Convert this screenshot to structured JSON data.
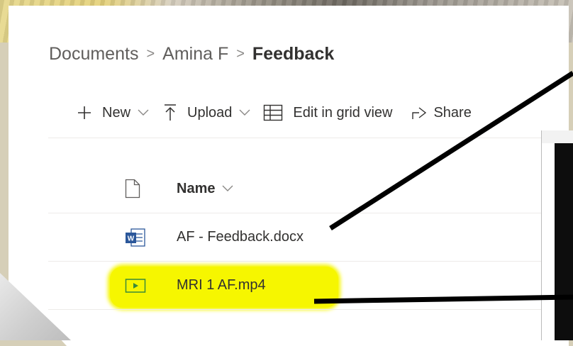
{
  "breadcrumb": {
    "items": [
      "Documents",
      "Amina F"
    ],
    "current": "Feedback",
    "separator": ">"
  },
  "toolbar": {
    "new_label": "New",
    "upload_label": "Upload",
    "edit_grid_label": "Edit in grid view",
    "share_label": "Share"
  },
  "list": {
    "header_name": "Name",
    "files": [
      {
        "name": "AF - Feedback.docx",
        "type": "word-doc-icon"
      },
      {
        "name": "MRI 1 AF.mp4",
        "type": "video-file-icon"
      }
    ]
  },
  "colors": {
    "highlight": "#f6f600",
    "word_blue": "#2b579a",
    "video_green": "#3a8a3a"
  }
}
